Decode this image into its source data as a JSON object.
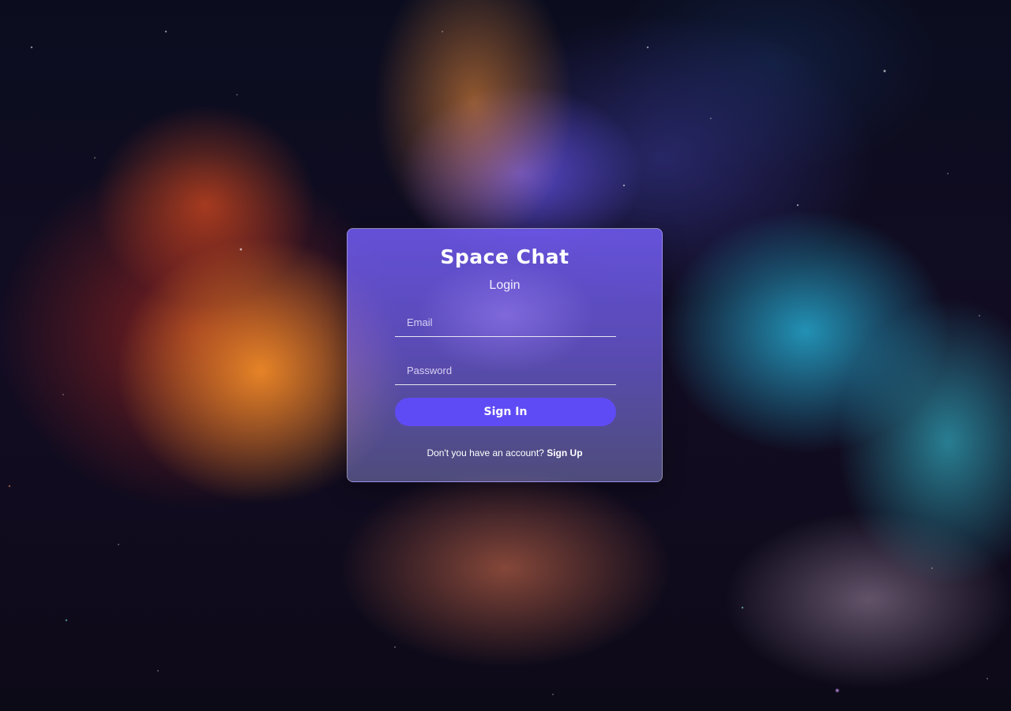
{
  "background": {
    "description_icon": "nebula-background"
  },
  "login_card": {
    "app_title": "Space Chat",
    "heading": "Login",
    "email": {
      "placeholder": "Email",
      "value": ""
    },
    "password": {
      "placeholder": "Password",
      "value": ""
    },
    "submit_label": "Sign In",
    "signup_prompt": "Don't you have an account?",
    "signup_link": "Sign Up"
  },
  "colors": {
    "button": "#5f4bf5",
    "card_tint": "#7060f0",
    "text": "#ffffff"
  }
}
